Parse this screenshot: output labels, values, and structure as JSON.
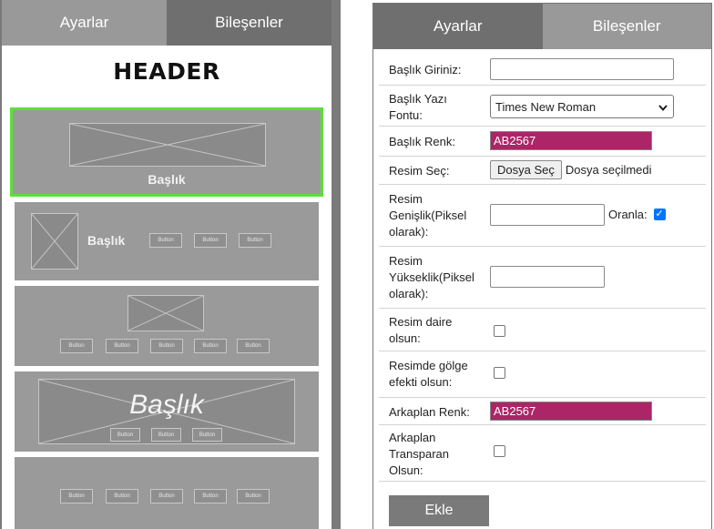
{
  "left": {
    "tabs": [
      "Ayarlar",
      "Bileşenler"
    ],
    "header": "HEADER",
    "templates": [
      {
        "title": "Başlık"
      },
      {
        "title": "Başlık",
        "buttons": [
          "Button",
          "Button",
          "Button"
        ]
      },
      {
        "buttons": [
          "Button",
          "Button",
          "Button",
          "Button",
          "Button"
        ]
      },
      {
        "title": "Başlık",
        "buttons": [
          "Button",
          "Button",
          "Button"
        ]
      },
      {
        "buttons": [
          "Button",
          "Button",
          "Button",
          "Button",
          "Button"
        ]
      }
    ]
  },
  "right": {
    "tabs": [
      "Ayarlar",
      "Bileşenler"
    ],
    "fields": {
      "title_input": {
        "label": "Başlık Giriniz:",
        "value": ""
      },
      "title_font": {
        "label": "Başlık Yazı Fontu:",
        "value": "Times New Roman"
      },
      "title_color": {
        "label": "Başlık Renk:",
        "value": "AB2567"
      },
      "image_select": {
        "label": "Resim Seç:",
        "button": "Dosya Seç",
        "status": "Dosya seçilmedi"
      },
      "image_width": {
        "label": "Resim Genişlik(Piksel olarak):",
        "value": "",
        "ratio_label": "Oranla:",
        "ratio_checked": true
      },
      "image_height": {
        "label": "Resim Yükseklik(Piksel olarak):",
        "value": ""
      },
      "image_circle": {
        "label": "Resim daire olsun:",
        "checked": false
      },
      "image_shadow": {
        "label": "Resimde gölge efekti olsun:",
        "checked": false
      },
      "bg_color": {
        "label": "Arkaplan Renk:",
        "value": "AB2567"
      },
      "bg_transparent": {
        "label": "Arkaplan Transparan Olsun:",
        "checked": false
      }
    },
    "add_button": "Ekle"
  },
  "colors": {
    "accent": "#ab2567",
    "selection": "#5be03a",
    "tab_dark": "#6f6f6f",
    "tab_light": "#999999"
  }
}
